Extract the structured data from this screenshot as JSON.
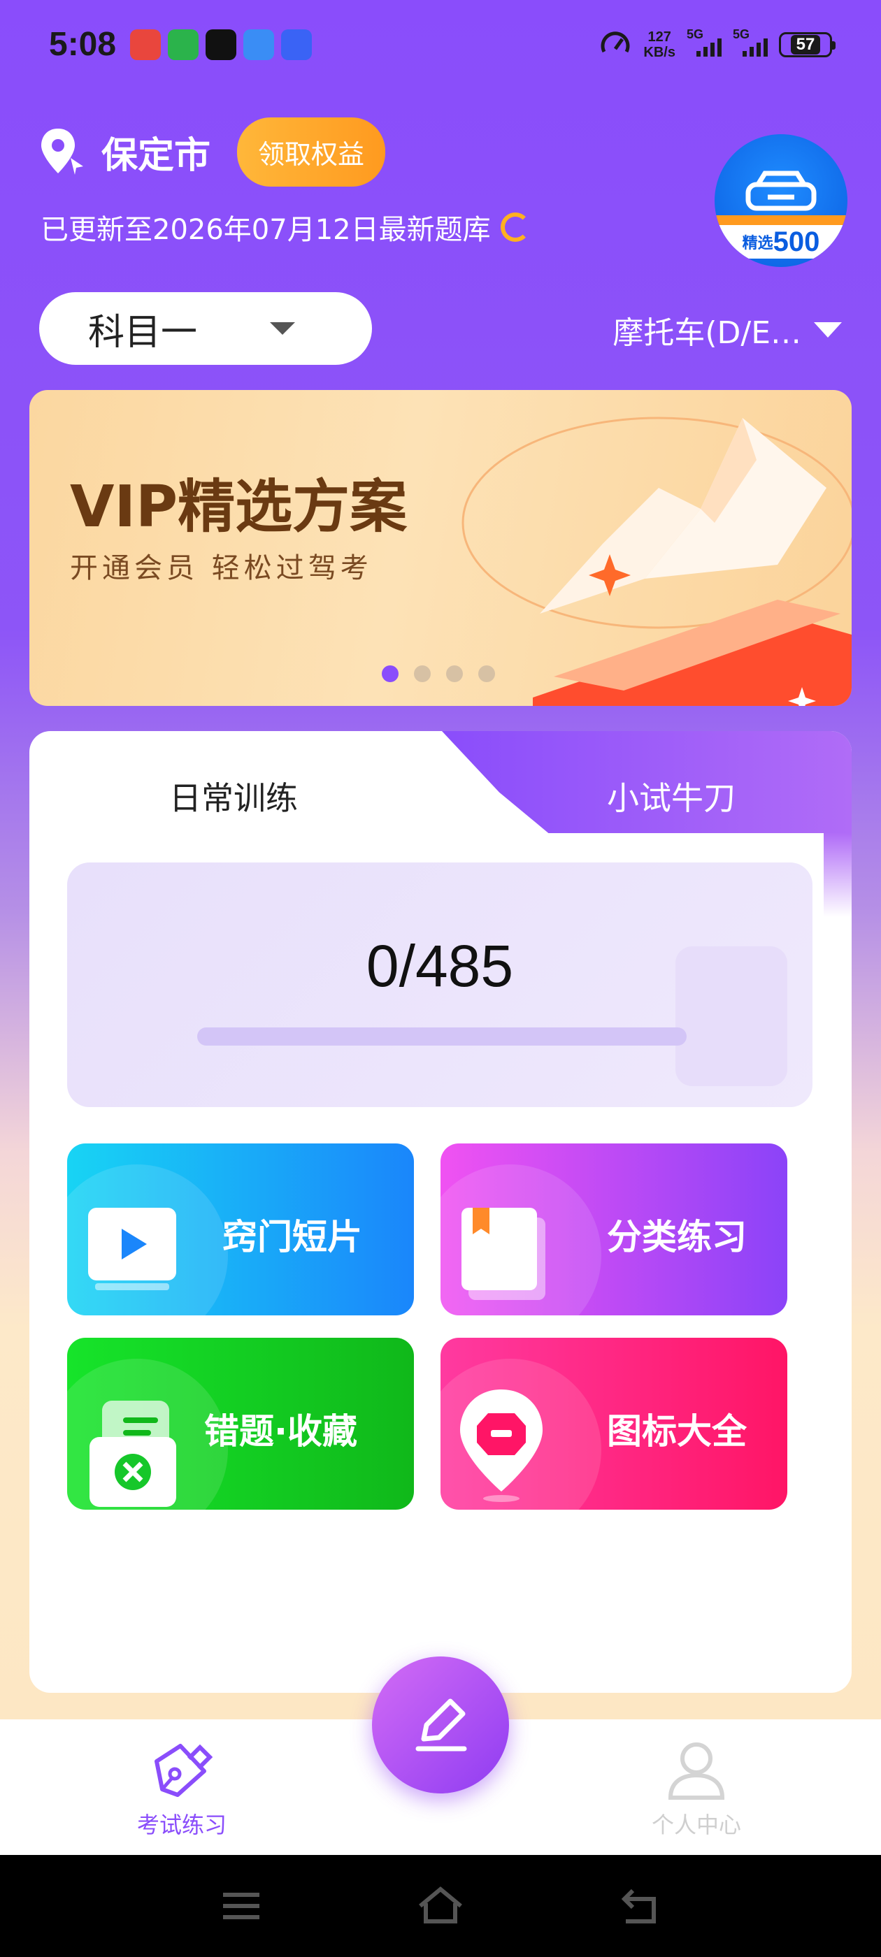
{
  "status_bar": {
    "time": "5:08",
    "net_speed_value": "127",
    "net_speed_unit": "KB/s",
    "sim1": "5G",
    "sim2": "5G",
    "battery": "57"
  },
  "header": {
    "city": "保定市",
    "benefit_button": "领取权益",
    "update_text": "已更新至2026年07月12日最新题库",
    "badge_text_small": "精选",
    "badge_text_big": "500"
  },
  "selectors": {
    "subject": "科目一",
    "vehicle": "摩托车(D/E…"
  },
  "banner": {
    "title": "VIP精选方案",
    "subtitle": "开通会员 轻松过驾考",
    "pages": 4,
    "active_page": 1
  },
  "tabs": {
    "daily": "日常训练",
    "try": "小试牛刀"
  },
  "progress": {
    "text": "0/485",
    "done": 0,
    "total": 485
  },
  "tiles": {
    "video": "窍门短片",
    "category": "分类练习",
    "wrong": "错题·收藏",
    "signs": "图标大全"
  },
  "bottom_nav": {
    "exam": "考试练习",
    "me": "个人中心"
  },
  "colors": {
    "accent": "#8a4dfb",
    "orange": "#ff9a1f"
  }
}
